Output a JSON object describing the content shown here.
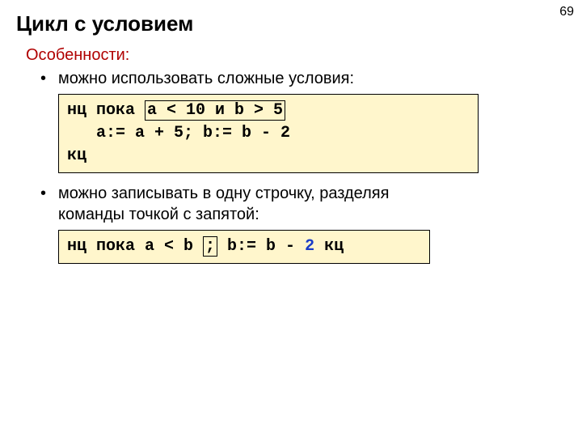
{
  "page_number": "69",
  "title": "Цикл с условием",
  "subtitle": "Особенности:",
  "bullets": {
    "b1": "можно использовать сложные условия:",
    "b2_line1": "можно записывать в одну строчку, разделяя",
    "b2_line2": "команды точкой с запятой:"
  },
  "code1": {
    "t1": "нц пока ",
    "hl": "a < 10 и b > 5",
    "t2": "   a:= a + 5; b:= b - 2",
    "t3": "кц"
  },
  "code2": {
    "t1": "нц пока a < b ",
    "hl": ";",
    "t2": " b:= b - ",
    "blue": "2",
    "t3": " кц"
  }
}
